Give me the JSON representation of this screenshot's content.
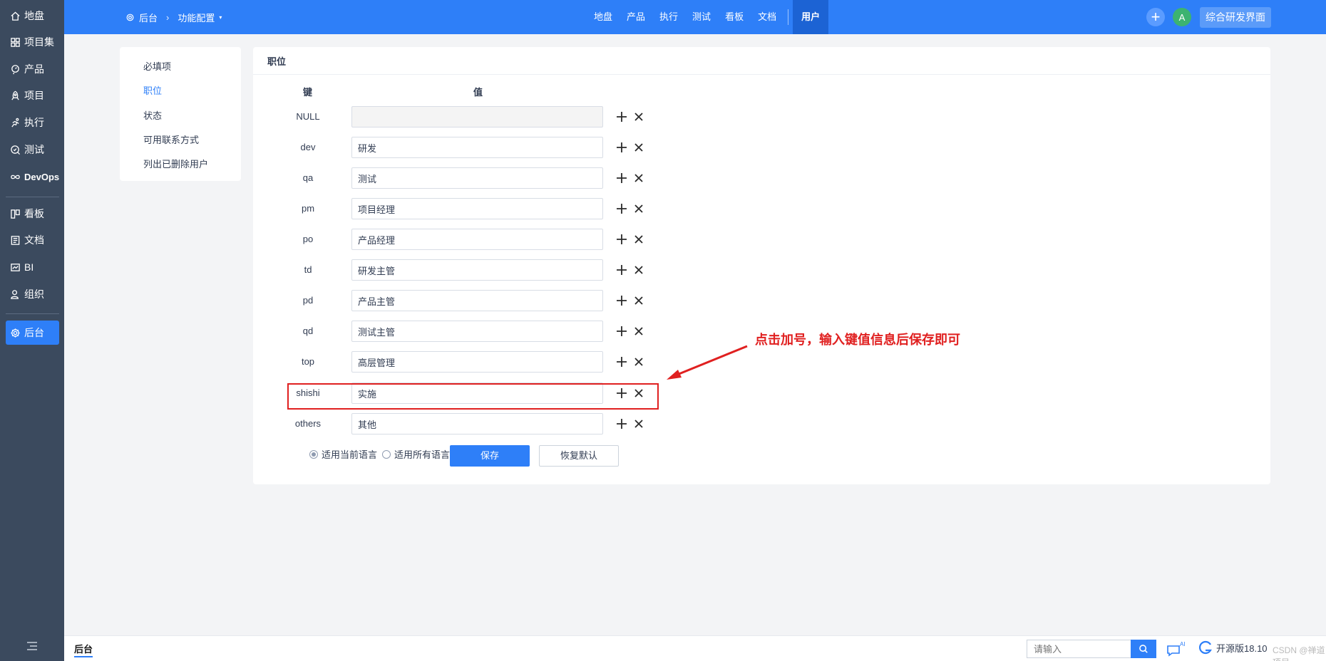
{
  "sidebar": {
    "items": [
      {
        "label": "地盘",
        "icon": "home-icon"
      },
      {
        "label": "项目集",
        "icon": "program-icon"
      },
      {
        "label": "产品",
        "icon": "product-icon"
      },
      {
        "label": "项目",
        "icon": "project-icon"
      },
      {
        "label": "执行",
        "icon": "execution-icon"
      },
      {
        "label": "测试",
        "icon": "test-icon"
      },
      {
        "label": "DevOps",
        "icon": "devops-icon"
      },
      {
        "label": "看板",
        "icon": "kanban-icon"
      },
      {
        "label": "文档",
        "icon": "doc-icon"
      },
      {
        "label": "BI",
        "icon": "bi-icon"
      },
      {
        "label": "组织",
        "icon": "org-icon"
      },
      {
        "label": "后台",
        "icon": "admin-gear-icon",
        "active": true
      }
    ]
  },
  "header": {
    "breadcrumb": {
      "root": "后台",
      "current": "功能配置"
    },
    "nav": [
      "地盘",
      "产品",
      "执行",
      "测试",
      "看板",
      "文档"
    ],
    "active_nav": "用户",
    "avatar_letter": "A",
    "workspace_button": "综合研发界面",
    "accent_color": "#2e7ff8"
  },
  "settings_menu": {
    "items": [
      "必填项",
      "职位",
      "状态",
      "可用联系方式",
      "列出已删除用户"
    ],
    "active_index": 1
  },
  "main": {
    "title": "职位",
    "col_key": "键",
    "col_value": "值",
    "rows": [
      {
        "key": "NULL",
        "value": ""
      },
      {
        "key": "dev",
        "value": "研发"
      },
      {
        "key": "qa",
        "value": "测试"
      },
      {
        "key": "pm",
        "value": "项目经理"
      },
      {
        "key": "po",
        "value": "产品经理"
      },
      {
        "key": "td",
        "value": "研发主管"
      },
      {
        "key": "pd",
        "value": "产品主管"
      },
      {
        "key": "qd",
        "value": "测试主管"
      },
      {
        "key": "top",
        "value": "高层管理"
      },
      {
        "key": "shishi",
        "value": "实施"
      },
      {
        "key": "others",
        "value": "其他"
      }
    ],
    "radio_current": "适用当前语言",
    "radio_all": "适用所有语言",
    "save_label": "保存",
    "reset_label": "恢复默认"
  },
  "annotation": {
    "callout_text": "点击加号，输入键值信息后保存即可",
    "color": "#e02020"
  },
  "footer": {
    "tab": "后台",
    "search_placeholder": "请输入",
    "ai_label": "AI",
    "version": "开源版18.10",
    "watermark": "CSDN @禅道项目"
  }
}
